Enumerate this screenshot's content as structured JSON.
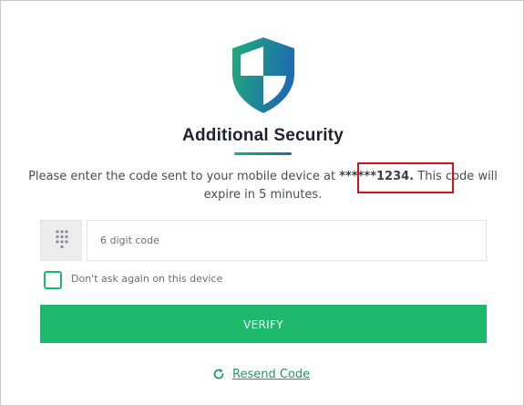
{
  "dialog": {
    "title": "Additional Security",
    "message_before": "Please enter the code sent to your mobile device at ",
    "masked_number": "******1234.",
    "message_after": " This code will expire in 5 minutes."
  },
  "code_field": {
    "placeholder": "6 digit code",
    "value": ""
  },
  "remember_device": {
    "label": "Don't ask again on this device",
    "checked": false
  },
  "verify_button": {
    "label": "VERIFY"
  },
  "resend": {
    "label": "Resend Code"
  },
  "icons": {
    "logo": "shield-icon",
    "keypad": "keypad-icon",
    "resend": "refresh-icon"
  },
  "colors": {
    "accent_green": "#1db86b",
    "shield_green": "#1fae76",
    "shield_blue": "#1f6bb0",
    "highlight_red": "#d0131b",
    "link_green": "#1a9e63"
  }
}
